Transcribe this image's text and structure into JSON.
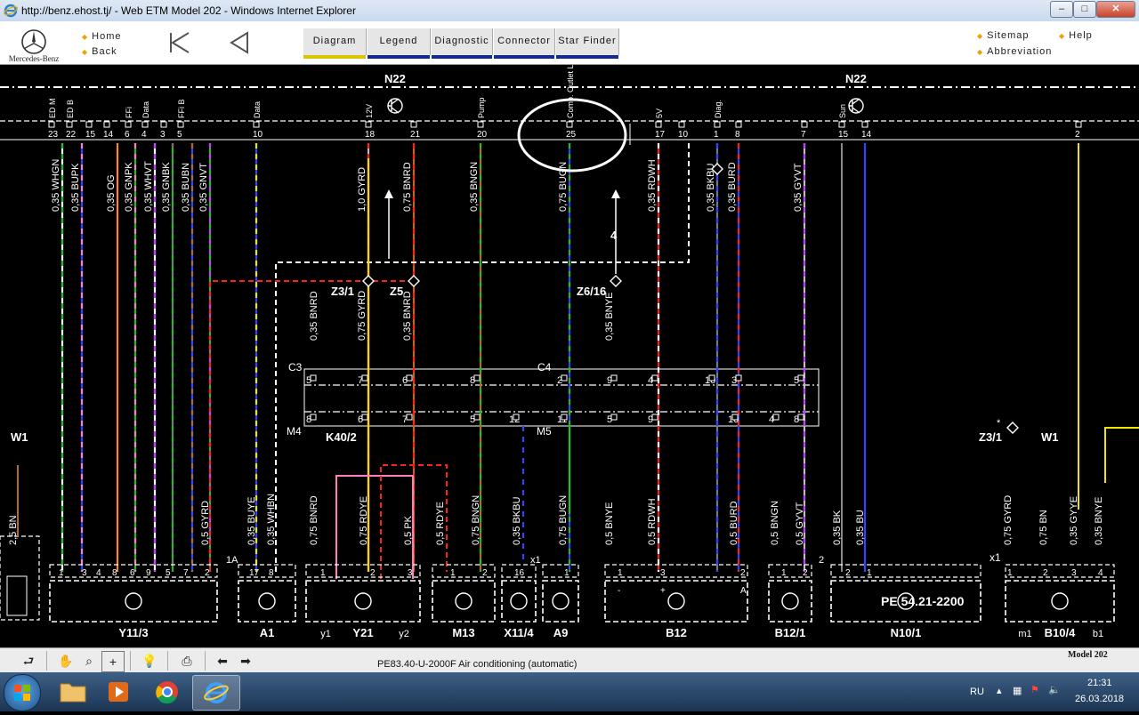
{
  "window": {
    "title": "http://benz.ehost.tj/ - Web ETM Model 202 - Windows Internet Explorer",
    "min_label": "–",
    "max_label": "□",
    "close_label": "✕"
  },
  "header": {
    "brand": "Mercedes-Benz",
    "home_label": "Home",
    "back_label": "Back",
    "tabs": [
      {
        "label": "Diagram",
        "active": true
      },
      {
        "label": "Legend",
        "active": false
      },
      {
        "label": "Diagnostic",
        "active": false
      },
      {
        "label": "Connector",
        "active": false
      },
      {
        "label": "Star Finder",
        "active": false
      }
    ],
    "sitemap_label": "Sitemap",
    "help_label": "Help",
    "abbreviation_label": "Abbreviation"
  },
  "diagram": {
    "top_labels": {
      "n22_left": "N22",
      "n22_right": "N22"
    },
    "top_pins": [
      {
        "num": "23",
        "sig": "ED M"
      },
      {
        "num": "22",
        "sig": "ED B"
      },
      {
        "num": "15",
        "sig": ""
      },
      {
        "num": "14",
        "sig": ""
      },
      {
        "num": "6",
        "sig": "FFi"
      },
      {
        "num": "4",
        "sig": "Data"
      },
      {
        "num": "3",
        "sig": ""
      },
      {
        "num": "5",
        "sig": "FFi B"
      },
      {
        "num": "10",
        "sig": "Data"
      },
      {
        "num": "18",
        "sig": "12V"
      },
      {
        "num": "21",
        "sig": ""
      },
      {
        "num": "20",
        "sig": "Pump"
      },
      {
        "num": "25",
        "sig": "Comp. Outlet LED W"
      },
      {
        "num": "17",
        "sig": "5V"
      },
      {
        "num": "10",
        "sig": ""
      },
      {
        "num": "1",
        "sig": "Diag."
      },
      {
        "num": "8",
        "sig": ""
      },
      {
        "num": "7",
        "sig": ""
      },
      {
        "num": "15",
        "sig": "Sun"
      },
      {
        "num": "14",
        "sig": ""
      },
      {
        "num": "2",
        "sig": ""
      }
    ],
    "upper_wires": [
      "0,35 WHGN",
      "0,35 BUPK",
      "0,35 OG",
      "0,35 GNPK",
      "0,35 WHVT",
      "0,35 GNBK",
      "0,35 BUBN",
      "0,35 GNVT",
      "1,0 GYRD",
      "0,75 BNRD",
      "0,35 BNGN",
      "0,75 BUGN",
      "0,35 RDWH",
      "0,35 BKBU",
      "0,35 BURD",
      "0,35 GYVT"
    ],
    "arrow_number": "4",
    "splices": {
      "z3_1": "Z3/1",
      "z5": "Z5",
      "z6_16": "Z6/16"
    },
    "mid_wires": [
      "0,35 BNRD",
      "0,75 GYRD",
      "0,35 BNRD",
      "0,35 BNYE"
    ],
    "connector_labels": {
      "c3": "C3",
      "c4": "C4",
      "m4": "M4",
      "m5": "M5",
      "k40_2": "K40/2"
    },
    "c3_pins": [
      "5",
      "7",
      "6",
      "8"
    ],
    "c4_pins": [
      "2",
      "9",
      "4",
      "10",
      "3",
      "5"
    ],
    "m4_pins": [
      "8",
      "6",
      "7",
      "5",
      "12"
    ],
    "m5_pins": [
      "11",
      "5",
      "9",
      "10",
      "4",
      "8"
    ],
    "lower_wires": [
      "2,5 BN",
      "0,5 GYRD",
      "0,35 BUYE",
      "0,35 WHBN",
      "0,75 BNRD",
      "0,75 RDYE",
      "0,5 PK",
      "0,5 RDYE",
      "0,75 BNGN",
      "0,35 BKBU",
      "0,75 BUGN",
      "0,5 BNYE",
      "0,5 RDWH",
      "0,5 BURD",
      "0,5 BNGN",
      "0,5 GYVT",
      "0,35 BK",
      "0,35 BU",
      "0,75 GYRD",
      "0,75 BN",
      "0,35 GYYE",
      "0,35 BNYE"
    ],
    "right_labels": {
      "z3_1_star": "*",
      "z3_1": "Z3/1",
      "w1": "W1",
      "x1": "x1"
    },
    "left_label": {
      "w1": "W1"
    },
    "components": [
      {
        "id": "Y11/3",
        "pins": [
          "1",
          "3",
          "4",
          "8",
          "6",
          "9",
          "5",
          "7",
          "2"
        ]
      },
      {
        "id": "A1",
        "pins": [
          "17",
          "8"
        ],
        "extra": "1A"
      },
      {
        "id": "Y21",
        "pins": [
          "1",
          "2",
          "3"
        ],
        "sub": [
          "y1",
          "y2"
        ]
      },
      {
        "id": "M13",
        "pins": [
          "1",
          "2"
        ]
      },
      {
        "id": "X11/4",
        "pins": [
          "16"
        ]
      },
      {
        "id": "A9",
        "pins": [
          "1"
        ],
        "extra": "x1"
      },
      {
        "id": "B12",
        "pins": [
          "1",
          "3",
          "2"
        ],
        "marks": [
          "-",
          "+",
          "A"
        ]
      },
      {
        "id": "B12/1",
        "pins": [
          "1",
          "2"
        ]
      },
      {
        "id": "N10/1",
        "pins": [
          "2",
          "1"
        ],
        "extra": "2",
        "ref": "PE 54.21-2200"
      },
      {
        "id": "B10/4",
        "pins": [
          "1",
          "2",
          "3",
          "4"
        ],
        "sub": [
          "m1",
          "b1"
        ]
      }
    ],
    "highlight": "ellipse"
  },
  "toolbar": {
    "caption": "PE83.40-U-2000F   Air conditioning (automatic)",
    "model": "Model 202"
  },
  "taskbar": {
    "lang": "RU",
    "time": "21:31",
    "date": "26.03.2018"
  },
  "colors": {
    "titlebar": "#c9d9ee",
    "tab_underline": "#152a8e",
    "tab_active": "#d9c400",
    "diagram_bg": "#000000",
    "wire_white": "#ffffff",
    "highlight_ring": "#ffffff"
  }
}
